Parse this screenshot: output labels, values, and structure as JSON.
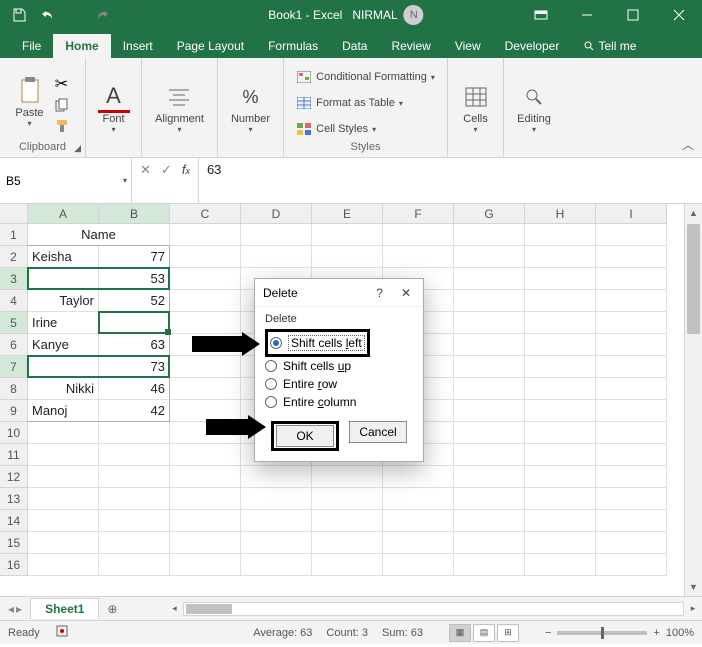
{
  "title": {
    "doc": "Book1 - Excel",
    "user": "NIRMAL",
    "avatar": "N"
  },
  "tabs": [
    "File",
    "Home",
    "Insert",
    "Page Layout",
    "Formulas",
    "Data",
    "Review",
    "View",
    "Developer",
    "Tell me"
  ],
  "active_tab": "Home",
  "ribbon": {
    "clipboard": {
      "paste": "Paste",
      "label": "Clipboard"
    },
    "font": {
      "btn": "Font",
      "label": "Font"
    },
    "alignment": {
      "btn": "Alignment",
      "label": "Alignment"
    },
    "number": {
      "btn": "Number",
      "label": "Number"
    },
    "styles": {
      "cond": "Conditional Formatting",
      "table": "Format as Table",
      "cell": "Cell Styles",
      "label": "Styles"
    },
    "cells": {
      "btn": "Cells",
      "label": "Cells"
    },
    "editing": {
      "btn": "Editing",
      "label": "Editing"
    }
  },
  "namebox": "B5",
  "formula": "63",
  "columns": [
    "A",
    "B",
    "C",
    "D",
    "E",
    "F",
    "G",
    "H",
    "I"
  ],
  "grid": {
    "header": "Name",
    "rows": [
      {
        "n": 1
      },
      {
        "n": 2,
        "a": "Keisha",
        "b": "77"
      },
      {
        "n": 3,
        "a": "",
        "b": "53"
      },
      {
        "n": 4,
        "a": "Taylor",
        "b": "52"
      },
      {
        "n": 5,
        "a": "Irine",
        "b": ""
      },
      {
        "n": 6,
        "a": "Kanye",
        "b": "63"
      },
      {
        "n": 7,
        "a": "",
        "b": "73"
      },
      {
        "n": 8,
        "a": "Nikki",
        "b": "46"
      },
      {
        "n": 9,
        "a": "Manoj",
        "b": "42"
      },
      {
        "n": 10
      },
      {
        "n": 11
      },
      {
        "n": 12
      },
      {
        "n": 13
      },
      {
        "n": 14
      },
      {
        "n": 15
      },
      {
        "n": 16
      }
    ]
  },
  "sheet": {
    "name": "Sheet1"
  },
  "status": {
    "ready": "Ready",
    "avg": "Average: 63",
    "count": "Count: 3",
    "sum": "Sum: 63",
    "zoom": "100%"
  },
  "dialog": {
    "title": "Delete",
    "group": "Delete",
    "opt_left": "Shift cells left",
    "opt_up": "Shift cells up",
    "opt_row": "Entire row",
    "opt_col": "Entire column",
    "ok": "OK",
    "cancel": "Cancel",
    "help": "?",
    "close": "✕"
  }
}
